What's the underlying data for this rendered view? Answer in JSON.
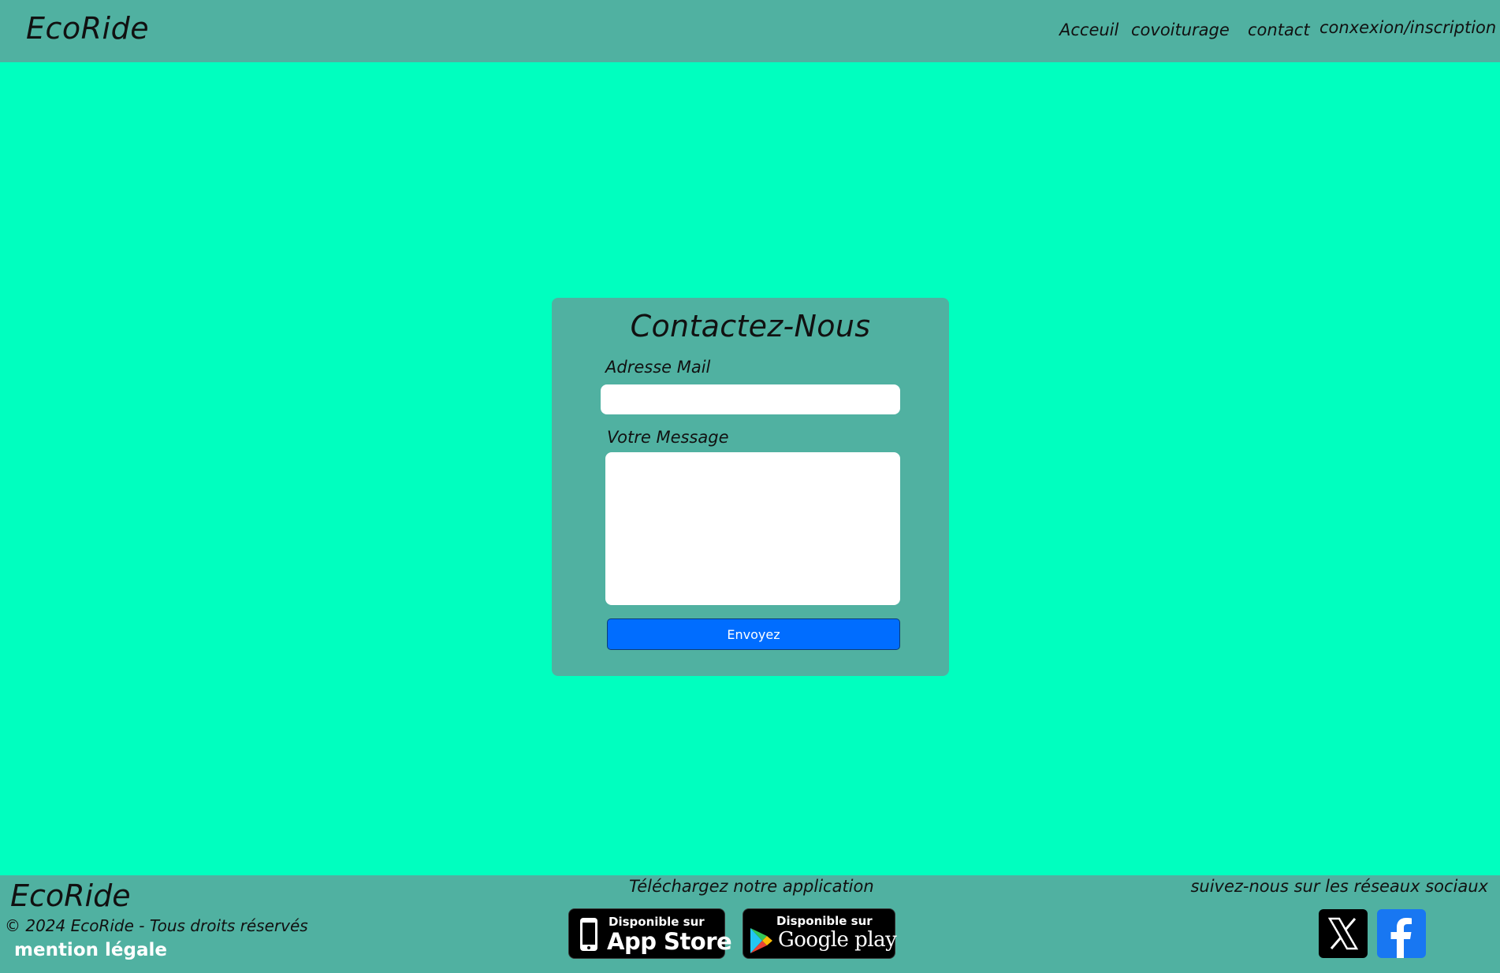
{
  "header": {
    "brand": "EcoRide",
    "nav": {
      "home": "Acceuil",
      "carpool": "covoiturage",
      "contact": "contact",
      "auth": "conxexion/inscription"
    }
  },
  "contact_form": {
    "title": "Contactez-Nous",
    "email_label": "Adresse Mail",
    "email_value": "",
    "message_label": "Votre Message",
    "message_value": "",
    "submit_label": "Envoyez"
  },
  "footer": {
    "brand": "EcoRide",
    "copyright": "© 2024 EcoRide - Tous droits réservés",
    "legal_link": "mention légale",
    "download_title": "Téléchargez notre application",
    "app_store": {
      "small": "Disponible sur",
      "big": "App Store",
      "icon": "iphone-icon"
    },
    "google_play": {
      "small": "Disponible sur",
      "big": "Google play",
      "icon": "play-triangle-icon"
    },
    "social_title": "suivez-nous sur les réseaux sociaux",
    "social": [
      {
        "icon": "x-twitter-icon",
        "color": "#000000"
      },
      {
        "icon": "facebook-icon",
        "color": "#1877f2"
      }
    ]
  },
  "colors": {
    "page_background": "#00ffbf",
    "bar_background": "#50b1a1",
    "button": "#006dff"
  }
}
